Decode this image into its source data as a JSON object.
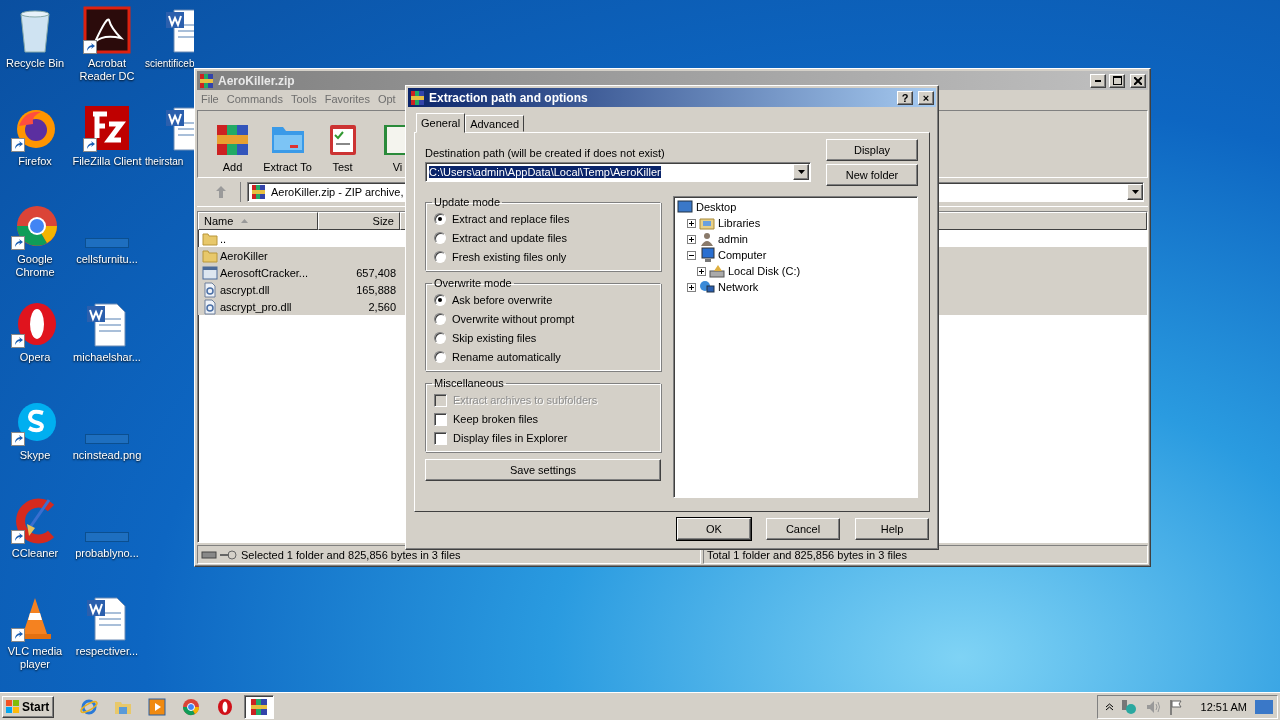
{
  "desktop_icons": [
    {
      "label": "Recycle Bin",
      "kind": "recycle",
      "shortcut": false
    },
    {
      "label": "Firefox",
      "kind": "firefox",
      "shortcut": true
    },
    {
      "label": "Google Chrome",
      "kind": "chrome",
      "shortcut": true
    },
    {
      "label": "Opera",
      "kind": "opera",
      "shortcut": true
    },
    {
      "label": "Skype",
      "kind": "skype",
      "shortcut": true
    },
    {
      "label": "CCleaner",
      "kind": "ccleaner",
      "shortcut": true
    },
    {
      "label": "VLC media player",
      "kind": "vlc",
      "shortcut": true
    },
    {
      "label": "Acrobat Reader DC",
      "kind": "acrobat",
      "shortcut": true
    },
    {
      "label": "FileZilla Client",
      "kind": "filezilla",
      "shortcut": true
    },
    {
      "label": "cellsfurnitu...",
      "kind": "blank",
      "shortcut": false
    },
    {
      "label": "michaelshar...",
      "kind": "word",
      "shortcut": false
    },
    {
      "label": "ncinstead.png",
      "kind": "blank",
      "shortcut": false
    },
    {
      "label": "probablyno...",
      "kind": "blank",
      "shortcut": false
    },
    {
      "label": "respectiver...",
      "kind": "word",
      "shortcut": false
    },
    {
      "label": "scientificeb",
      "kind": "word",
      "shortcut": false
    },
    {
      "label": "theirstan",
      "kind": "word",
      "shortcut": false
    }
  ],
  "archive_window": {
    "title": "AeroKiller.zip",
    "menu": [
      "File",
      "Commands",
      "Tools",
      "Favorites",
      "Opt"
    ],
    "toolbar": [
      {
        "label": "Add",
        "kind": "add"
      },
      {
        "label": "Extract To",
        "kind": "extract"
      },
      {
        "label": "Test",
        "kind": "test"
      },
      {
        "label": "Vi",
        "kind": "view"
      }
    ],
    "address": "AeroKiller.zip - ZIP archive,",
    "columns": [
      "Name",
      "Size"
    ],
    "files": [
      {
        "name": "..",
        "kind": "folder",
        "selected": false
      },
      {
        "name": "AeroKiller",
        "kind": "folder",
        "selected": true
      },
      {
        "name": "AerosoftCracker...",
        "size": "657,408",
        "kind": "exe",
        "selected": true
      },
      {
        "name": "ascrypt.dll",
        "size": "165,888",
        "kind": "dll",
        "selected": true
      },
      {
        "name": "ascrypt_pro.dll",
        "size": "2,560",
        "kind": "dll",
        "selected": true
      }
    ],
    "status_left": "Selected 1 folder and 825,856 bytes in 3 files",
    "status_right": "Total 1 folder and 825,856 bytes in 3 files"
  },
  "dialog": {
    "title": "Extraction path and options",
    "title_buttons": [
      "?",
      "×"
    ],
    "tabs": [
      {
        "label": "General",
        "selected": true
      },
      {
        "label": "Advanced",
        "selected": false
      }
    ],
    "path_label": "Destination path (will be created if does not exist)",
    "path_value": "C:\\Users\\admin\\AppData\\Local\\Temp\\AeroKiller",
    "side_buttons": [
      "Display",
      "New folder"
    ],
    "groups": [
      {
        "title": "Update mode",
        "options": [
          {
            "label": "Extract and replace files",
            "kind": "radio",
            "selected": true
          },
          {
            "label": "Extract and update files",
            "kind": "radio",
            "selected": false
          },
          {
            "label": "Fresh existing files only",
            "kind": "radio",
            "selected": false
          }
        ]
      },
      {
        "title": "Overwrite mode",
        "options": [
          {
            "label": "Ask before overwrite",
            "kind": "radio",
            "selected": true
          },
          {
            "label": "Overwrite without prompt",
            "kind": "radio",
            "selected": false
          },
          {
            "label": "Skip existing files",
            "kind": "radio",
            "selected": false
          },
          {
            "label": "Rename automatically",
            "kind": "radio",
            "selected": false
          }
        ]
      },
      {
        "title": "Miscellaneous",
        "options": [
          {
            "label": "Extract archives to subfolders",
            "kind": "checkbox",
            "checked": false,
            "disabled": true
          },
          {
            "label": "Keep broken files",
            "kind": "checkbox",
            "checked": false,
            "disabled": false
          },
          {
            "label": "Display files in Explorer",
            "kind": "checkbox",
            "checked": false,
            "disabled": false
          }
        ]
      }
    ],
    "save_button": "Save settings",
    "tree": [
      {
        "label": "Desktop",
        "kind": "desktop",
        "children": [
          {
            "label": "Libraries",
            "kind": "libraries",
            "expanded": false
          },
          {
            "label": "admin",
            "kind": "user",
            "expanded": false
          },
          {
            "label": "Computer",
            "kind": "computer",
            "expanded": true,
            "children": [
              {
                "label": "Local Disk (C:)",
                "kind": "disk",
                "expanded": false
              }
            ]
          },
          {
            "label": "Network",
            "kind": "network",
            "expanded": false
          }
        ]
      }
    ],
    "buttons": [
      {
        "label": "OK",
        "default": true
      },
      {
        "label": "Cancel",
        "default": false
      },
      {
        "label": "Help",
        "default": false
      }
    ]
  },
  "taskbar": {
    "start": "Start",
    "apps": [
      {
        "kind": "ie",
        "active": false
      },
      {
        "kind": "explorer",
        "active": false
      },
      {
        "kind": "media",
        "active": false
      },
      {
        "kind": "chrome",
        "active": false
      },
      {
        "kind": "opera",
        "active": false
      },
      {
        "kind": "winrar",
        "active": true
      }
    ],
    "clock": "12:51 AM"
  }
}
